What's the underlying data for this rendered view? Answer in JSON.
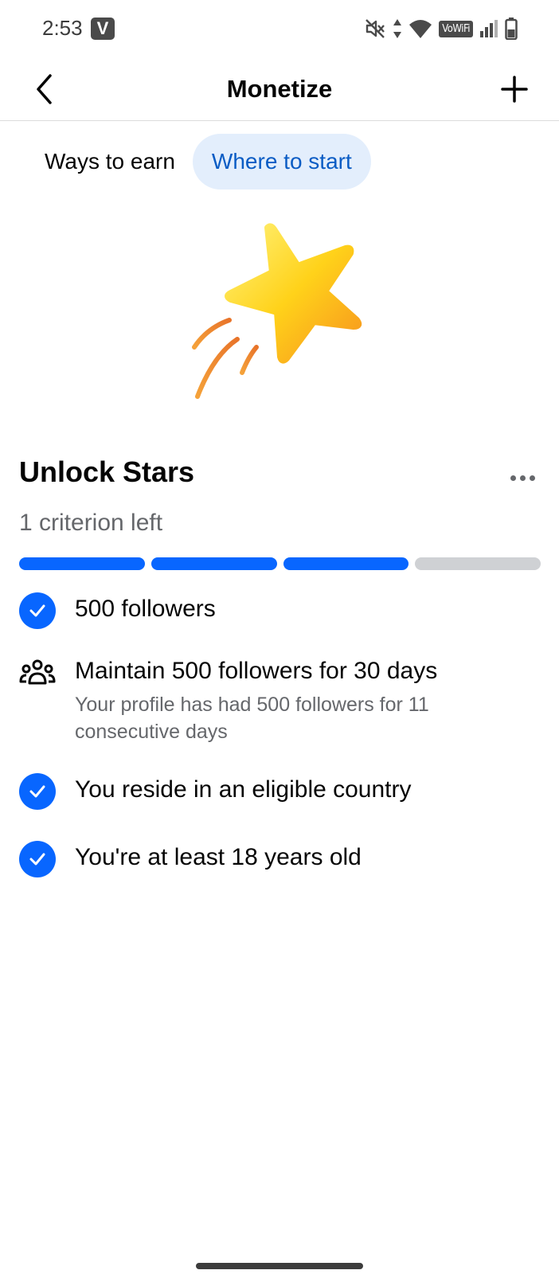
{
  "status_bar": {
    "time": "2:53",
    "app_badge": "V",
    "vowifi": "VoWiFi",
    "icons": [
      "mute-icon",
      "data-arrows-icon",
      "wifi-icon",
      "vowifi-icon",
      "signal-icon",
      "battery-icon"
    ]
  },
  "header": {
    "title": "Monetize",
    "back_icon": "chevron-left-icon",
    "add_icon": "plus-icon"
  },
  "tabs": [
    {
      "label": "Ways to earn",
      "active": false
    },
    {
      "label": "Where to start",
      "active": true
    }
  ],
  "illustration": "shooting-star-icon",
  "section": {
    "title": "Unlock Stars",
    "subtitle": "1 criterion left",
    "progress": {
      "completed": 3,
      "total": 4
    }
  },
  "criteria": [
    {
      "text": "500 followers",
      "status": "complete",
      "icon": "check-circle-icon"
    },
    {
      "text": "Maintain 500 followers for 30 days",
      "detail": "Your profile has had 500 followers for 11 consecutive days",
      "status": "incomplete",
      "icon": "people-group-icon"
    },
    {
      "text": "You reside in an eligible country",
      "status": "complete",
      "icon": "check-circle-icon"
    },
    {
      "text": "You're at least 18 years old",
      "status": "complete",
      "icon": "check-circle-icon"
    }
  ],
  "colors": {
    "accent": "#0866ff",
    "tab_active_bg": "#e3eefc",
    "tab_active_text": "#0a5cc4",
    "secondary_text": "#65676b",
    "progress_remaining": "#cfd1d4"
  }
}
